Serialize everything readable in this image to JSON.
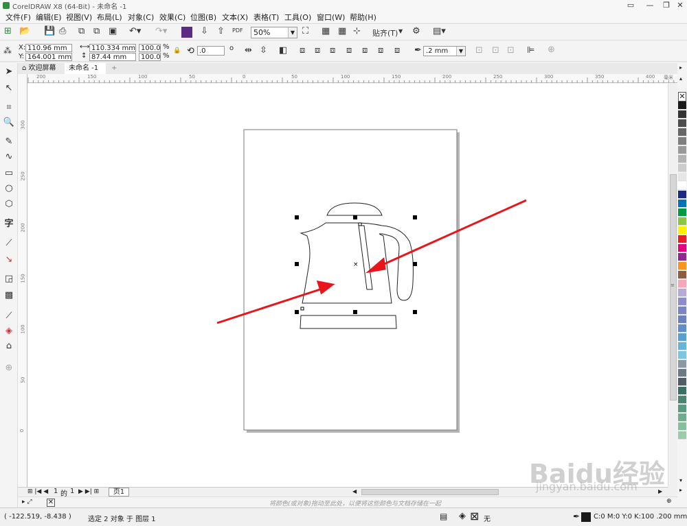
{
  "window": {
    "title": "CorelDRAW X8 (64-Bit) - 未命名 -1",
    "controls": [
      "minimize-icon",
      "restore-icon",
      "close-icon"
    ]
  },
  "menu": [
    "文件(F)",
    "编辑(E)",
    "视图(V)",
    "布局(L)",
    "对象(C)",
    "效果(C)",
    "位图(B)",
    "文本(X)",
    "表格(T)",
    "工具(O)",
    "窗口(W)",
    "帮助(H)"
  ],
  "toolbar": {
    "zoom": "50%",
    "snap_label": "贴齐(T)",
    "pdf_label": "PDF"
  },
  "propbar": {
    "x_label": "X:",
    "x_value": "110.96 mm",
    "y_label": "Y:",
    "y_value": "164.001 mm",
    "width_value": "110.334 mm",
    "height_value": "87.44 mm",
    "scale_w": "100.0",
    "scale_h": "100.0",
    "percent": "%",
    "rotation": ".0",
    "degree": "o",
    "outline_width": ".2 mm"
  },
  "tabs": {
    "welcome": "欢迎屏幕",
    "document": "未命名 -1",
    "add": "+"
  },
  "ruler": {
    "h_ticks": [
      "200",
      "150",
      "100",
      "50",
      "0",
      "50",
      "100",
      "150",
      "200",
      "250",
      "300",
      "350",
      "400"
    ],
    "h_unit": "毫米",
    "v_ticks": [
      "300",
      "250",
      "200",
      "150",
      "100",
      "50",
      "0"
    ]
  },
  "pagenav": {
    "current": "1",
    "of": "的",
    "total": "1",
    "page_tab": "页1"
  },
  "colorhint": "将颜色(或对象)拖动至此处，以便将这些颜色与文档存储在一起",
  "status": {
    "coords": "( -122.519, -8.438 )",
    "selection": "选定 2 对象 于 图层 1",
    "fill_none": "无",
    "outline_info": "C:0 M:0 Y:0 K:100 .200 mm"
  },
  "watermark": {
    "brand": "Baidu经验",
    "url": "jingyan.baidu.com"
  },
  "palette_colors": [
    "#1a1a1a",
    "#333333",
    "#4d4d4d",
    "#666666",
    "#7f7f7f",
    "#999999",
    "#b3b3b3",
    "#cccccc",
    "#e6e6e6",
    "#ffffff",
    "#1b2a7f",
    "#0072bc",
    "#009a44",
    "#8dc63f",
    "#fff200",
    "#ed1c24",
    "#e4007f",
    "#92278f",
    "#f7941d",
    "#8b5e3c",
    "#f4a7b9",
    "#b8a9d6",
    "#8e8cc9",
    "#7a86c4",
    "#6c7fbf",
    "#5d8fc9",
    "#5aa0cf",
    "#63b5da",
    "#7cc6e0",
    "#8a9aa5",
    "#6b7b85",
    "#4f5d66",
    "#3c6e62",
    "#4c8474",
    "#5a9a82",
    "#6eae8e",
    "#84c09b",
    "#9acca8"
  ],
  "accent": {
    "arrow": "#e8161b",
    "handle": "#000000"
  }
}
